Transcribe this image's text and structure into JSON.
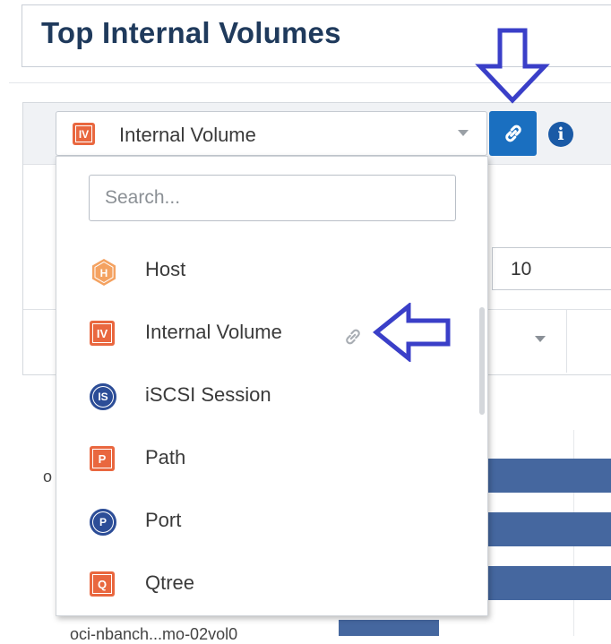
{
  "header": {
    "title": "Top Internal Volumes"
  },
  "toolbar": {
    "object_type": {
      "label": "Internal Volume",
      "icon": "internal-volume-icon",
      "icon_text": "IV"
    },
    "link_button_icon": "link-icon",
    "info_icon": "info-icon"
  },
  "top_n": {
    "value": "10"
  },
  "dropdown": {
    "search_placeholder": "Search...",
    "items": [
      {
        "label": "Host",
        "icon": "host-icon",
        "icon_text": "H"
      },
      {
        "label": "Internal Volume",
        "icon": "internal-volume-icon",
        "icon_text": "IV",
        "linked": true
      },
      {
        "label": "iSCSI Session",
        "icon": "iscsi-session-icon",
        "icon_text": "IS"
      },
      {
        "label": "Path",
        "icon": "path-icon",
        "icon_text": "P"
      },
      {
        "label": "Port",
        "icon": "port-icon",
        "icon_text": "P"
      },
      {
        "label": "Qtree",
        "icon": "qtree-icon",
        "icon_text": "Q"
      }
    ]
  },
  "chart_bg": {
    "axis_label_fragment": "o",
    "row_label_fragment": "oci-nbanch...mo-02vol0"
  },
  "colors": {
    "accent": "#1a6fc0",
    "annotation_arrow": "#3a3fc8",
    "orange_badge": "#e9673f",
    "blue_badge": "#2c4d97",
    "bar": "#45679f"
  }
}
